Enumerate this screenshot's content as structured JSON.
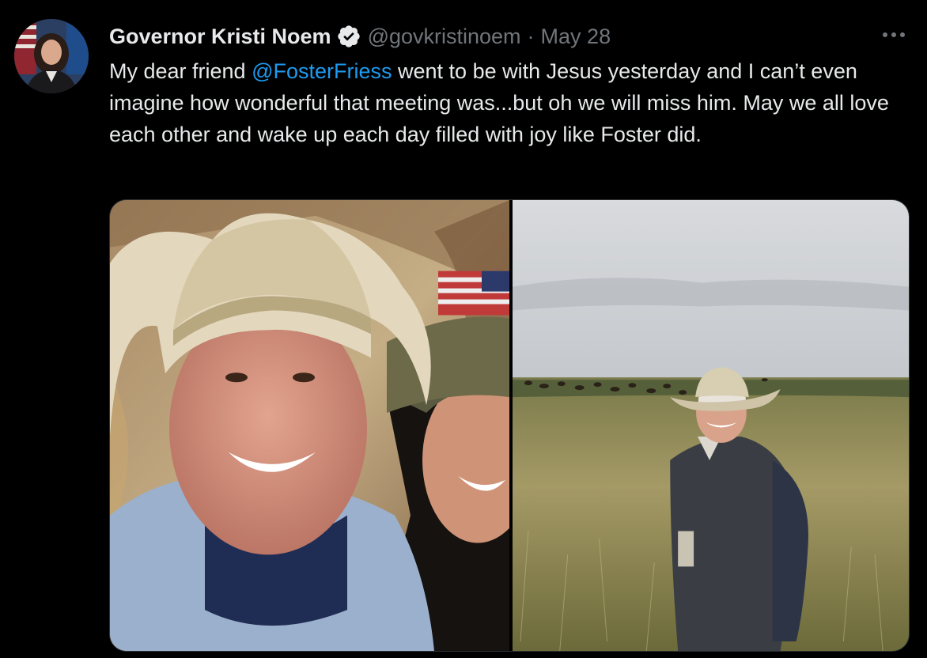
{
  "tweet": {
    "display_name": "Governor Kristi Noem",
    "handle": "@govkristinoem",
    "separator": "·",
    "date": "May 28",
    "text_before_mention": "My dear friend ",
    "mention": "@FosterFriess",
    "text_after_mention": " went to be with Jesus yesterday and I can’t even imagine how wonderful that meeting was...but oh we will miss him. May we all love each other and wake up each day filled with joy like Foster did.",
    "verified_icon": "verified-badge-icon",
    "more_icon": "more-options-icon"
  },
  "media": {
    "photos": [
      {
        "alt": "selfie"
      },
      {
        "alt": "prairie"
      }
    ]
  },
  "colors": {
    "background": "#000000",
    "text_primary": "#e7e9ea",
    "text_secondary": "#71767b",
    "link": "#1d9bf0"
  }
}
